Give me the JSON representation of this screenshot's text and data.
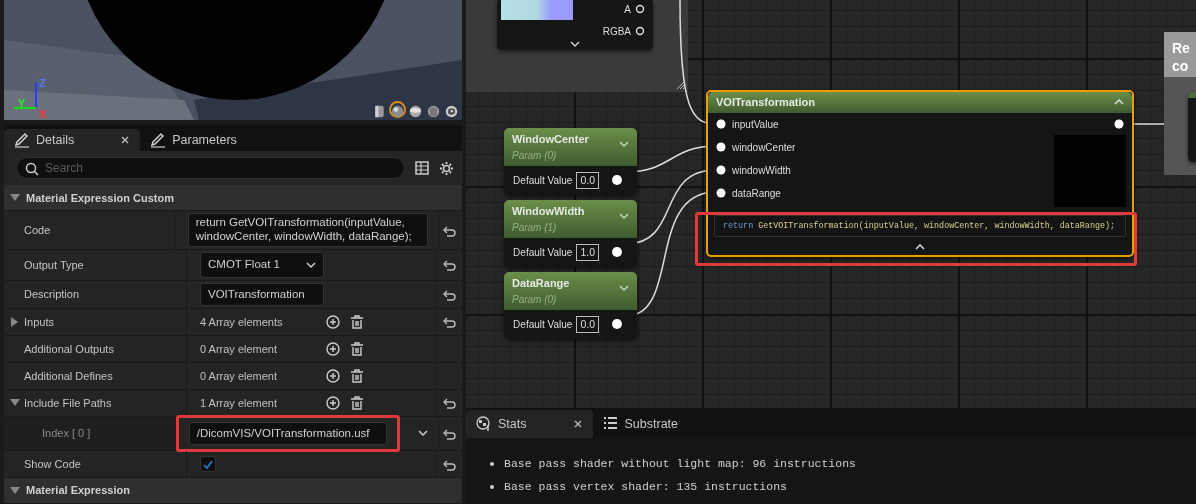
{
  "viewport": {
    "kind": "picture",
    "axis_labels": [
      "Z",
      "Y",
      "X"
    ],
    "preview_shapes": [
      {
        "kind": "cylinder",
        "selected": false
      },
      {
        "kind": "sphere",
        "selected": true
      },
      {
        "kind": "plane",
        "selected": false
      },
      {
        "kind": "cube",
        "selected": false
      },
      {
        "kind": "mesh",
        "selected": false
      }
    ]
  },
  "details": {
    "tabs": [
      {
        "label": "Details",
        "selected": true,
        "closable": true
      },
      {
        "label": "Parameters",
        "selected": false,
        "closable": false
      }
    ],
    "search": {
      "placeholder": "Search"
    },
    "categories": [
      {
        "title": "Material Expression Custom",
        "expanded": true,
        "properties": [
          {
            "label": "Code",
            "kind": "code",
            "value": "return GetVOITransformation(inputValue, windowCenter, windowWidth, dataRange);",
            "resettable": true
          },
          {
            "label": "Output Type",
            "kind": "dropdown",
            "value": "CMOT Float 1",
            "resettable": true
          },
          {
            "label": "Description",
            "kind": "text",
            "value": "VOITransformation",
            "resettable": true
          },
          {
            "label": "Inputs",
            "kind": "array",
            "value": "4 Array elements",
            "expanded": false,
            "resettable": true
          },
          {
            "label": "Additional Outputs",
            "kind": "array",
            "value": "0 Array element",
            "resettable": false
          },
          {
            "label": "Additional Defines",
            "kind": "array",
            "value": "0 Array element",
            "resettable": false
          },
          {
            "label": "Include File Paths",
            "kind": "array",
            "value": "1 Array element",
            "expanded": true,
            "resettable": true,
            "children": [
              {
                "label": "Index [ 0 ]",
                "kind": "path",
                "value": "/DicomVIS/VOITransformation.usf",
                "highlighted": true,
                "resettable": true
              }
            ]
          },
          {
            "label": "Show Code",
            "kind": "checkbox",
            "checked": true,
            "resettable": true
          }
        ]
      },
      {
        "title": "Material Expression",
        "expanded": true
      }
    ]
  },
  "graph": {
    "texture_node": {
      "pins": [
        "A",
        "RGBA"
      ]
    },
    "param_nodes": [
      {
        "name": "WindowCenter",
        "subtitle": "Param (0)",
        "field_label": "Default Value",
        "value": "0.0"
      },
      {
        "name": "WindowWidth",
        "subtitle": "Param (1)",
        "field_label": "Default Value",
        "value": "1.0"
      },
      {
        "name": "DataRange",
        "subtitle": "Param (0)",
        "field_label": "Default Value",
        "value": "0.0"
      }
    ],
    "custom_node": {
      "title": "VOITransformation",
      "selected": true,
      "inputs": [
        "inputValue",
        "windowCenter",
        "windowWidth",
        "dataRange"
      ],
      "code": {
        "keyword": "return",
        "expression": "GetVOITransformation(inputValue, windowCenter, windowWidth, dataRange);"
      },
      "highlighted": true
    },
    "comment": {
      "lines": [
        "Re",
        "co"
      ]
    }
  },
  "stats": {
    "tabs": [
      {
        "label": "Stats",
        "selected": true,
        "closable": true
      },
      {
        "label": "Substrate",
        "selected": false,
        "closable": false
      }
    ],
    "lines": [
      "Base pass shader without light map: 96 instructions",
      "Base pass vertex shader: 135 instructions"
    ]
  }
}
